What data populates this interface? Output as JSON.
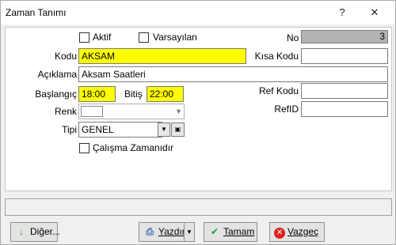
{
  "window": {
    "title": "Zaman Tanımı",
    "help": "?",
    "close": "✕"
  },
  "form": {
    "aktif_label": "Aktif",
    "varsayilan_label": "Varsayılan",
    "no_label": "No",
    "no_value": "3",
    "kodu_label": "Kodu",
    "kodu_value": "AKSAM",
    "kisa_kodu_label": "Kısa Kodu",
    "kisa_kodu_value": "",
    "aciklama_label": "Açıklama",
    "aciklama_value": "Aksam Saatleri",
    "baslangic_label": "Başlangıç",
    "baslangic_value": "18:00",
    "bitis_label": "Bitiş",
    "bitis_value": "22:00",
    "ref_kodu_label": "Ref Kodu",
    "ref_kodu_value": "",
    "refid_label": "RefID",
    "refid_value": "",
    "renk_label": "Renk",
    "tipi_label": "Tipi",
    "tipi_value": "GENEL",
    "calisma_label": "Çalışma Zamanıdır"
  },
  "buttons": {
    "diger": "Diğer...",
    "yazdir": "Yazdır",
    "tamam": "Tamam",
    "vazgec": "Vazgeç"
  },
  "icons": {
    "diger": "green-down-arrow-icon",
    "yazdir": "print-preview-icon",
    "tamam": "green-check-icon",
    "vazgec": "red-x-icon"
  }
}
